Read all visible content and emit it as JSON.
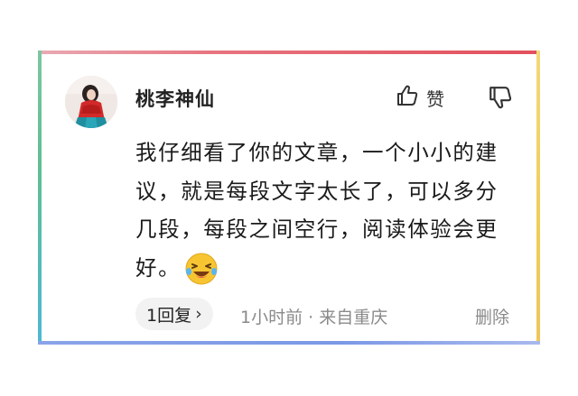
{
  "comment_card": {
    "username": "桃李神仙",
    "like_label": "赞",
    "text": "我仔细看了你的文章，一个小小的建议，就是每段文字太长了，可以多分几段，每段之间空行，阅读体验会更好。",
    "reply_label": "1回复",
    "reply_chevron": "›",
    "meta": "1小时前 · 来自重庆",
    "delete_label": "删除"
  },
  "icons": {
    "like": "thumbs-up-icon",
    "dislike": "thumbs-down-icon",
    "emoji": "laughing-emoji-icon"
  },
  "colors": {
    "border_top": "#e2505c",
    "border_left": "#5fbf92",
    "border_right": "#f0cd5a",
    "border_bottom": "#7b98e6",
    "meta_text": "#8a8a8a"
  }
}
